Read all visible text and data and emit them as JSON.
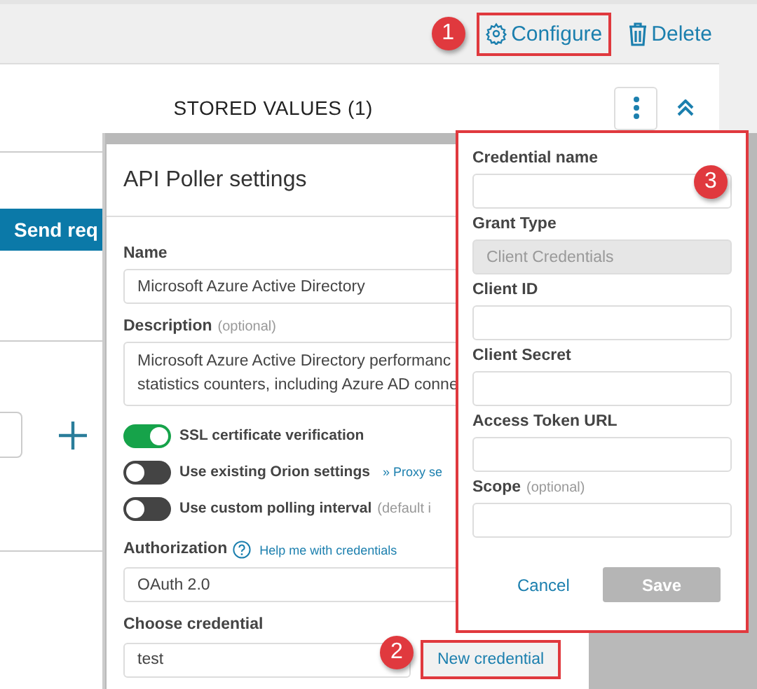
{
  "toolbar": {
    "callout": "1",
    "configure": "Configure",
    "delete": "Delete"
  },
  "card": {
    "title": "STORED VALUES (1)",
    "send_button": "Send req"
  },
  "dialog": {
    "title": "API Poller settings",
    "name": {
      "label": "Name",
      "value": "Microsoft Azure Active Directory"
    },
    "description": {
      "label": "Description",
      "hint": "(optional)",
      "lines": [
        "Microsoft Azure Active Directory performanc",
        "statistics counters, including Azure AD conne"
      ]
    },
    "toggles": [
      {
        "label": "SSL certificate verification",
        "on": true
      },
      {
        "label": "Use existing Orion settings",
        "on": false,
        "link": "» Proxy se"
      },
      {
        "label": "Use custom polling interval",
        "on": false,
        "hint": "(default i"
      }
    ],
    "authorization": {
      "label": "Authorization",
      "help": "Help me with credentials",
      "value": "OAuth 2.0"
    },
    "credential": {
      "label": "Choose credential",
      "value": "test",
      "callout": "2",
      "new_button": "New credential"
    }
  },
  "popover": {
    "callout": "3",
    "fields": [
      {
        "label": "Credential name",
        "disabled": false
      },
      {
        "label": "Grant Type",
        "value": "Client Credentials",
        "disabled": true
      },
      {
        "label": "Client ID",
        "disabled": false
      },
      {
        "label": "Client Secret",
        "disabled": false
      },
      {
        "label": "Access Token URL",
        "disabled": false
      },
      {
        "label": "Scope",
        "hint": "(optional)",
        "disabled": false
      }
    ],
    "cancel": "Cancel",
    "save": "Save"
  }
}
